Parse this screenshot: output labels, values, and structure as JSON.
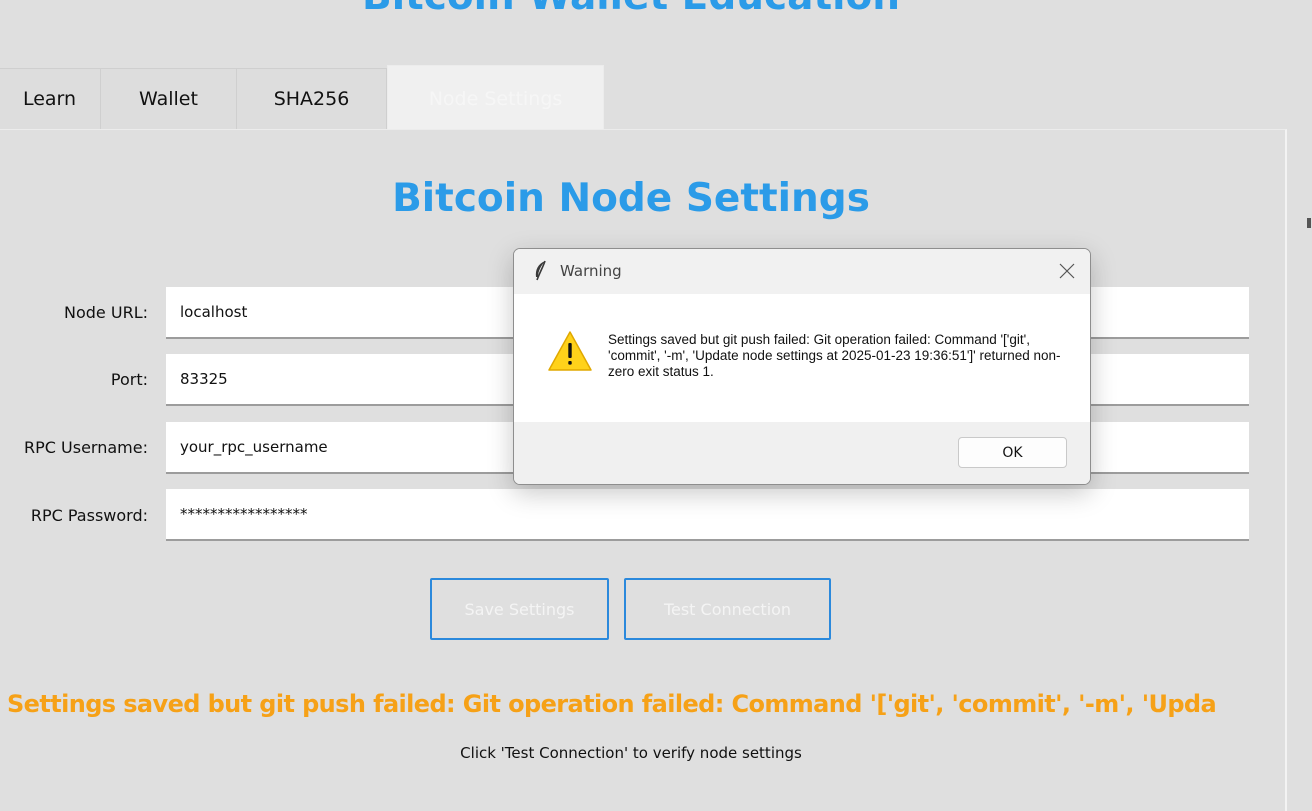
{
  "app": {
    "title": "Bitcoin Wallet Education"
  },
  "tabs": [
    {
      "label": "Learn"
    },
    {
      "label": "Wallet"
    },
    {
      "label": "SHA256"
    },
    {
      "label": "Node Settings"
    }
  ],
  "page": {
    "title": "Bitcoin Node Settings"
  },
  "fields": {
    "node_url": {
      "label": "Node URL:",
      "value": "localhost"
    },
    "port": {
      "label": "Port:",
      "value": "83325"
    },
    "rpc_username": {
      "label": "RPC Username:",
      "value": "your_rpc_username"
    },
    "rpc_password": {
      "label": "RPC Password:",
      "value": "*****************"
    }
  },
  "buttons": {
    "save": "Save Settings",
    "test": "Test Connection"
  },
  "status": {
    "error": "Settings saved but git push failed: Git operation failed: Command '['git', 'commit', '-m', 'Upda",
    "hint": "Click 'Test Connection' to verify node settings"
  },
  "dialog": {
    "title": "Warning",
    "message": "Settings saved but git push failed: Git operation failed: Command '['git', 'commit', '-m', 'Update node settings at 2025-01-23 19:36:51']' returned non-zero exit status 1.",
    "ok_label": "OK",
    "icon": "warning-triangle"
  },
  "colors": {
    "accent": "#2b9be8",
    "error": "#f6a117",
    "button_border": "#2b89dc",
    "warning_icon": "#ffd21a"
  }
}
